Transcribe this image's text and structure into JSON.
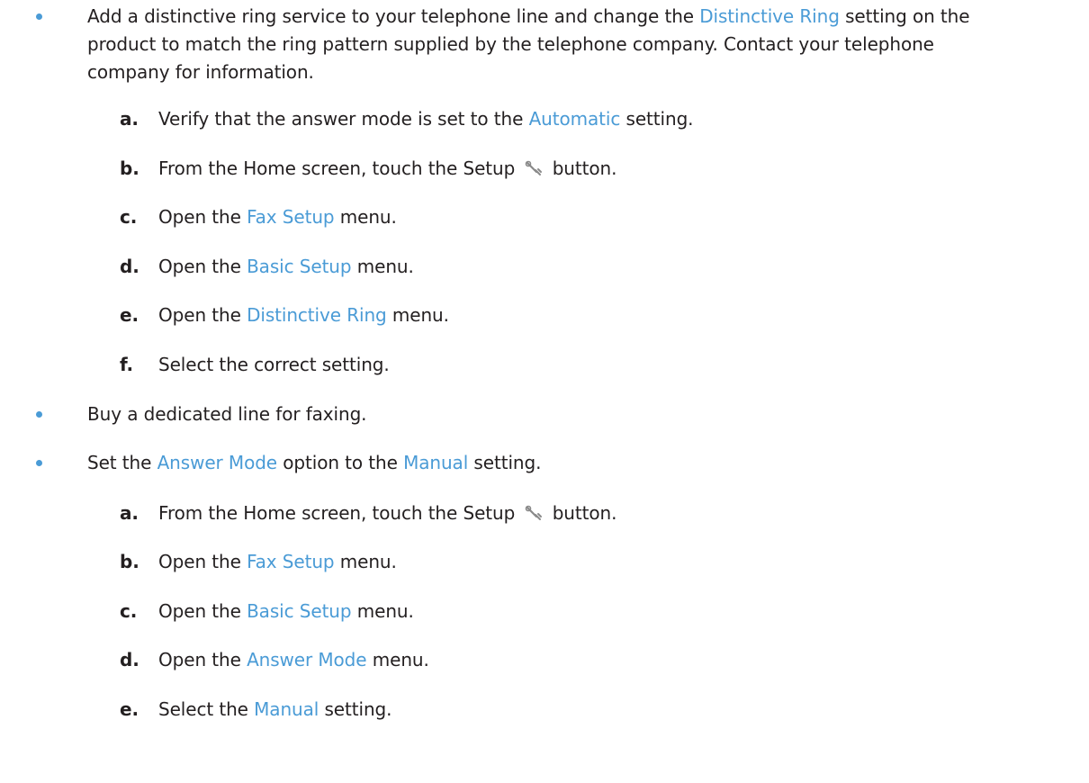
{
  "colors": {
    "text": "#231f20",
    "ui_term": "#4a9bd6",
    "bullet": "#4a9bd6"
  },
  "bullets": [
    {
      "lines": [
        [
          "Add a distinctive ring service to your telephone line and change the ",
          "Distinctive Ring",
          " setting on the"
        ],
        "product to match the ring pattern supplied by the telephone company. Contact your telephone",
        "company for information."
      ],
      "steps": [
        {
          "letter": "a.",
          "parts": [
            "Verify that the answer mode is set to the ",
            "Automatic",
            " setting."
          ]
        },
        {
          "letter": "b.",
          "parts": [
            "From the Home screen, touch the Setup ",
            "",
            " button."
          ],
          "icon": "wrench-icon"
        },
        {
          "letter": "c.",
          "parts": [
            "Open the ",
            "Fax Setup",
            " menu."
          ]
        },
        {
          "letter": "d.",
          "parts": [
            "Open the ",
            "Basic Setup",
            " menu."
          ]
        },
        {
          "letter": "e.",
          "parts": [
            "Open the ",
            "Distinctive Ring",
            " menu."
          ]
        },
        {
          "letter": "f.",
          "parts": [
            "Select the correct setting.",
            "",
            ""
          ]
        }
      ]
    },
    {
      "lines": [
        "Buy a dedicated line for faxing."
      ],
      "steps": []
    },
    {
      "lines": [
        [
          "Set the ",
          "Answer Mode",
          " option to the ",
          "Manual",
          " setting."
        ]
      ],
      "steps": [
        {
          "letter": "a.",
          "parts": [
            "From the Home screen, touch the Setup ",
            "",
            " button."
          ],
          "icon": "wrench-icon"
        },
        {
          "letter": "b.",
          "parts": [
            "Open the ",
            "Fax Setup",
            " menu."
          ]
        },
        {
          "letter": "c.",
          "parts": [
            "Open the ",
            "Basic Setup",
            " menu."
          ]
        },
        {
          "letter": "d.",
          "parts": [
            "Open the ",
            "Answer Mode",
            " menu."
          ]
        },
        {
          "letter": "e.",
          "parts": [
            "Select the ",
            "Manual",
            " setting."
          ]
        }
      ]
    }
  ]
}
